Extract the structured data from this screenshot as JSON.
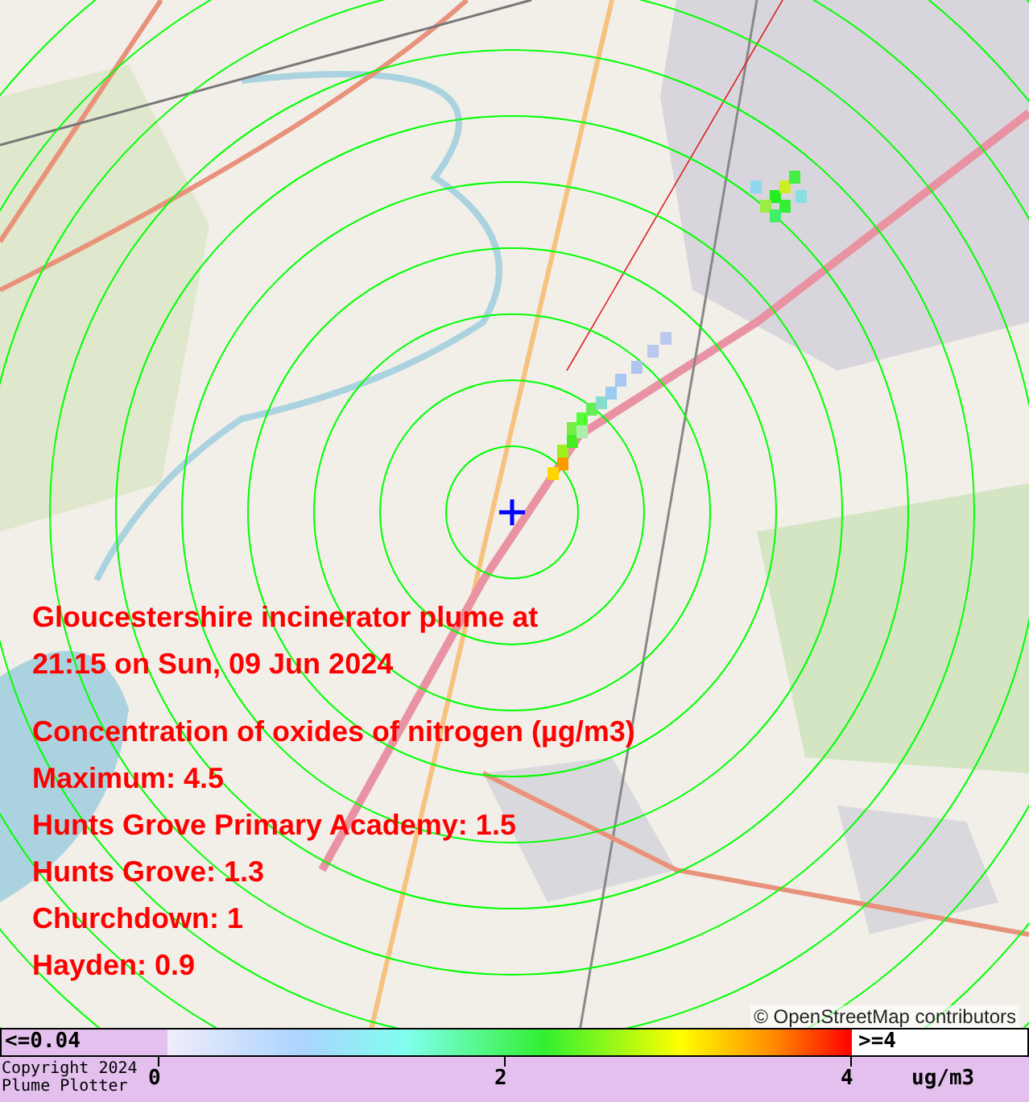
{
  "plume_info": {
    "title_lines": [
      "Gloucestershire incinerator plume at",
      "21:15 on Sun, 09 Jun 2024"
    ],
    "heading": "Concentration of oxides of nitrogen (µg/m3)",
    "readings": [
      "Maximum: 4.5",
      "Hunts Grove Primary Academy: 1.5",
      "Hunts Grove: 1.3",
      "Churchdown: 1",
      "Hayden: 0.9"
    ]
  },
  "attribution": "© OpenStreetMap contributors",
  "legend": {
    "low_label": "<=0.04",
    "high_label": ">=4",
    "ticks": [
      "0",
      "2",
      "4"
    ],
    "unit": "ug/m3",
    "copyright_lines": [
      "Copyright 2024",
      "Plume Plotter"
    ]
  }
}
